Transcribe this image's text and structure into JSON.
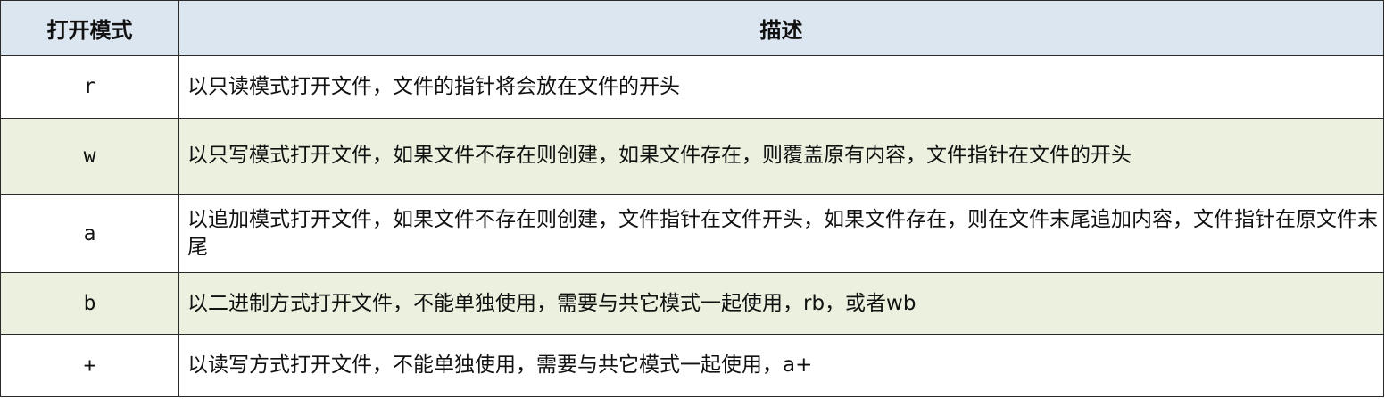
{
  "table": {
    "headers": {
      "mode": "打开模式",
      "description": "描述"
    },
    "rows": [
      {
        "mode": "r",
        "description": "以只读模式打开文件，文件的指针将会放在文件的开头"
      },
      {
        "mode": "w",
        "description": "以只写模式打开文件，如果文件不存在则创建，如果文件存在，则覆盖原有内容，文件指针在文件的开头"
      },
      {
        "mode": "a",
        "description": "以追加模式打开文件，如果文件不存在则创建，文件指针在文件开头，如果文件存在，则在文件末尾追加内容，文件指针在原文件末尾"
      },
      {
        "mode": "b",
        "description": "以二进制方式打开文件，不能单独使用，需要与共它模式一起使用，rb，或者wb"
      },
      {
        "mode": "+",
        "description": "以读写方式打开文件，不能单独使用，需要与共它模式一起使用，a+"
      }
    ]
  },
  "colors": {
    "header_bg": "#dce6f1",
    "alt_row_bg": "#ebf1de",
    "border": "#2a2a2a"
  }
}
